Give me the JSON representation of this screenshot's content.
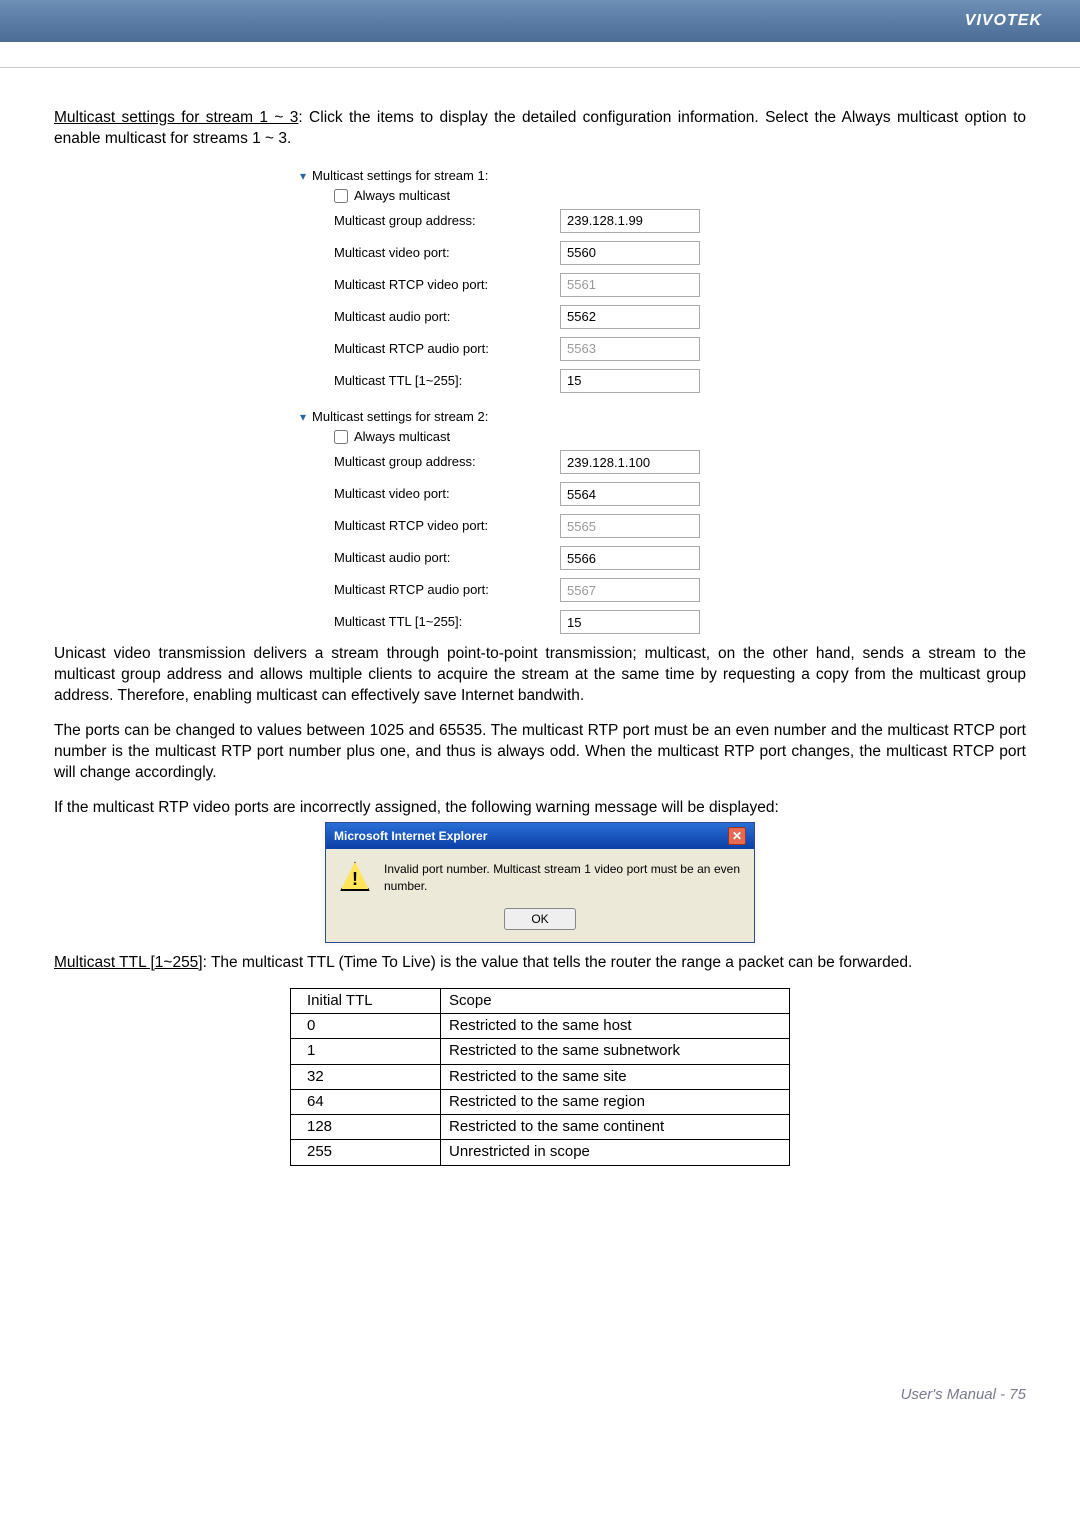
{
  "brand": "VIVOTEK",
  "intro_underline": "Multicast settings for stream 1 ~ 3",
  "intro_rest": ": Click the items to display the detailed configuration information. Select the Always multicast option to enable multicast for streams 1 ~ 3.",
  "always_multicast": "Always multicast",
  "labels": {
    "group_addr": "Multicast group address:",
    "video_port": "Multicast video port:",
    "rtcp_video": "Multicast RTCP video port:",
    "audio_port": "Multicast audio port:",
    "rtcp_audio": "Multicast RTCP audio port:",
    "ttl": "Multicast TTL [1~255]:"
  },
  "stream1": {
    "title": "Multicast settings for stream 1:",
    "group_addr": "239.128.1.99",
    "video_port": "5560",
    "rtcp_video": "5561",
    "audio_port": "5562",
    "rtcp_audio": "5563",
    "ttl": "15"
  },
  "stream2": {
    "title": "Multicast settings for stream 2:",
    "group_addr": "239.128.1.100",
    "video_port": "5564",
    "rtcp_video": "5565",
    "audio_port": "5566",
    "rtcp_audio": "5567",
    "ttl": "15"
  },
  "para_unicast": "Unicast video transmission delivers a stream through point-to-point transmission; multicast, on the other hand, sends a stream to the multicast group address and allows multiple clients to acquire the stream at the same time by requesting a copy from the multicast group address. Therefore, enabling multicast can effectively save Internet bandwith.",
  "para_ports": "The ports can be changed to values between 1025 and 65535. The multicast RTP port must be an even number and the multicast RTCP port number is the multicast RTP port number plus one, and thus is always odd. When the multicast RTP port changes, the multicast RTCP port will change accordingly.",
  "para_warn": "If the multicast RTP video ports are incorrectly assigned, the following warning message will be displayed:",
  "dialog": {
    "title": "Microsoft Internet Explorer",
    "msg": "Invalid port number. Multicast stream 1 video port must be an even number.",
    "ok": "OK"
  },
  "ttl_underline": "Multicast TTL [1~255]",
  "ttl_rest": ": The multicast TTL (Time To Live) is the value that tells the router the range a packet can be forwarded.",
  "table": {
    "h1": "Initial TTL",
    "h2": "Scope",
    "rows": [
      {
        "ttl": "0",
        "scope": "Restricted to the same host"
      },
      {
        "ttl": "1",
        "scope": "Restricted to the same subnetwork"
      },
      {
        "ttl": "32",
        "scope": "Restricted to the same site"
      },
      {
        "ttl": "64",
        "scope": "Restricted to the same region"
      },
      {
        "ttl": "128",
        "scope": "Restricted to the same continent"
      },
      {
        "ttl": "255",
        "scope": "Unrestricted in scope"
      }
    ]
  },
  "footer": "User's Manual - 75"
}
